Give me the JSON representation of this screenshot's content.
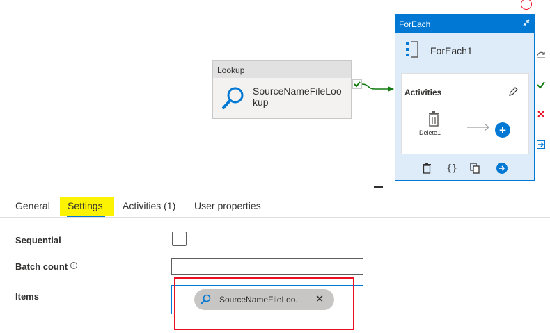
{
  "canvas": {
    "lookup": {
      "header": "Lookup",
      "name": "SourceNameFileLookup"
    },
    "foreach": {
      "header": "ForEach",
      "name": "ForEach1",
      "activities_title": "Activities",
      "inner_activity": "Delete1"
    }
  },
  "tabs": [
    {
      "label": "General"
    },
    {
      "label": "Settings"
    },
    {
      "label": "Activities (1)"
    },
    {
      "label": "User properties"
    }
  ],
  "active_tab": "Settings",
  "form": {
    "sequential": {
      "label": "Sequential",
      "checked": false
    },
    "batch_count": {
      "label": "Batch count",
      "info": "i",
      "value": ""
    },
    "items": {
      "label": "Items",
      "chip_text": "SourceNameFileLoo..."
    }
  },
  "colors": {
    "accent": "#0078d4",
    "success": "#107c10",
    "error": "#e81123",
    "highlight": "#fbf301"
  },
  "icons": {
    "lookup": "magnifier-icon",
    "foreach": "foreach-icon",
    "delete": "trash-icon",
    "edit": "pencil-icon",
    "add": "plus-circle-icon",
    "close": "close-icon"
  }
}
